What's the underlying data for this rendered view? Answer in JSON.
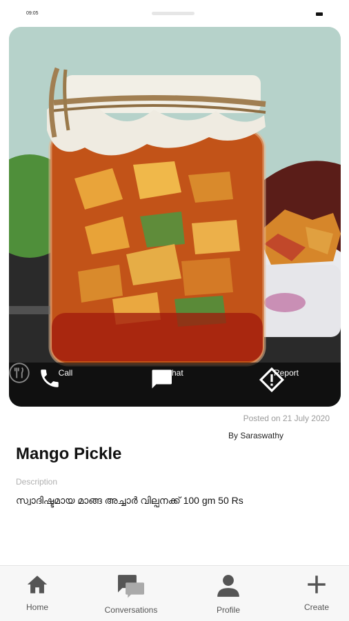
{
  "status_bar": {
    "time": "09:05"
  },
  "post": {
    "title": "Mango Pickle",
    "posted": "Posted on 21 July 2020",
    "author": "By Saraswathy",
    "description_label": "Description",
    "description": "സ്വാദിഷ്ടമായ മാങ്ങ അച്ചാർ വില്പനക്ക്  100 gm 50 Rs"
  },
  "actions": {
    "call": "Call",
    "chat": "Chat",
    "report": "Report"
  },
  "nav": {
    "home": "Home",
    "conversations": "Conversations",
    "profile": "Profile",
    "create": "Create"
  },
  "colors": {
    "nav_icon": "#555555",
    "action_overlay": "#000000",
    "text_muted": "#9a9a9a"
  },
  "icons": {
    "call": "phone-icon",
    "chat": "chat-bubble-icon",
    "report": "warning-diamond-icon",
    "home": "home-icon",
    "conversations": "chat-bubbles-icon",
    "profile": "person-icon",
    "create": "plus-icon"
  }
}
